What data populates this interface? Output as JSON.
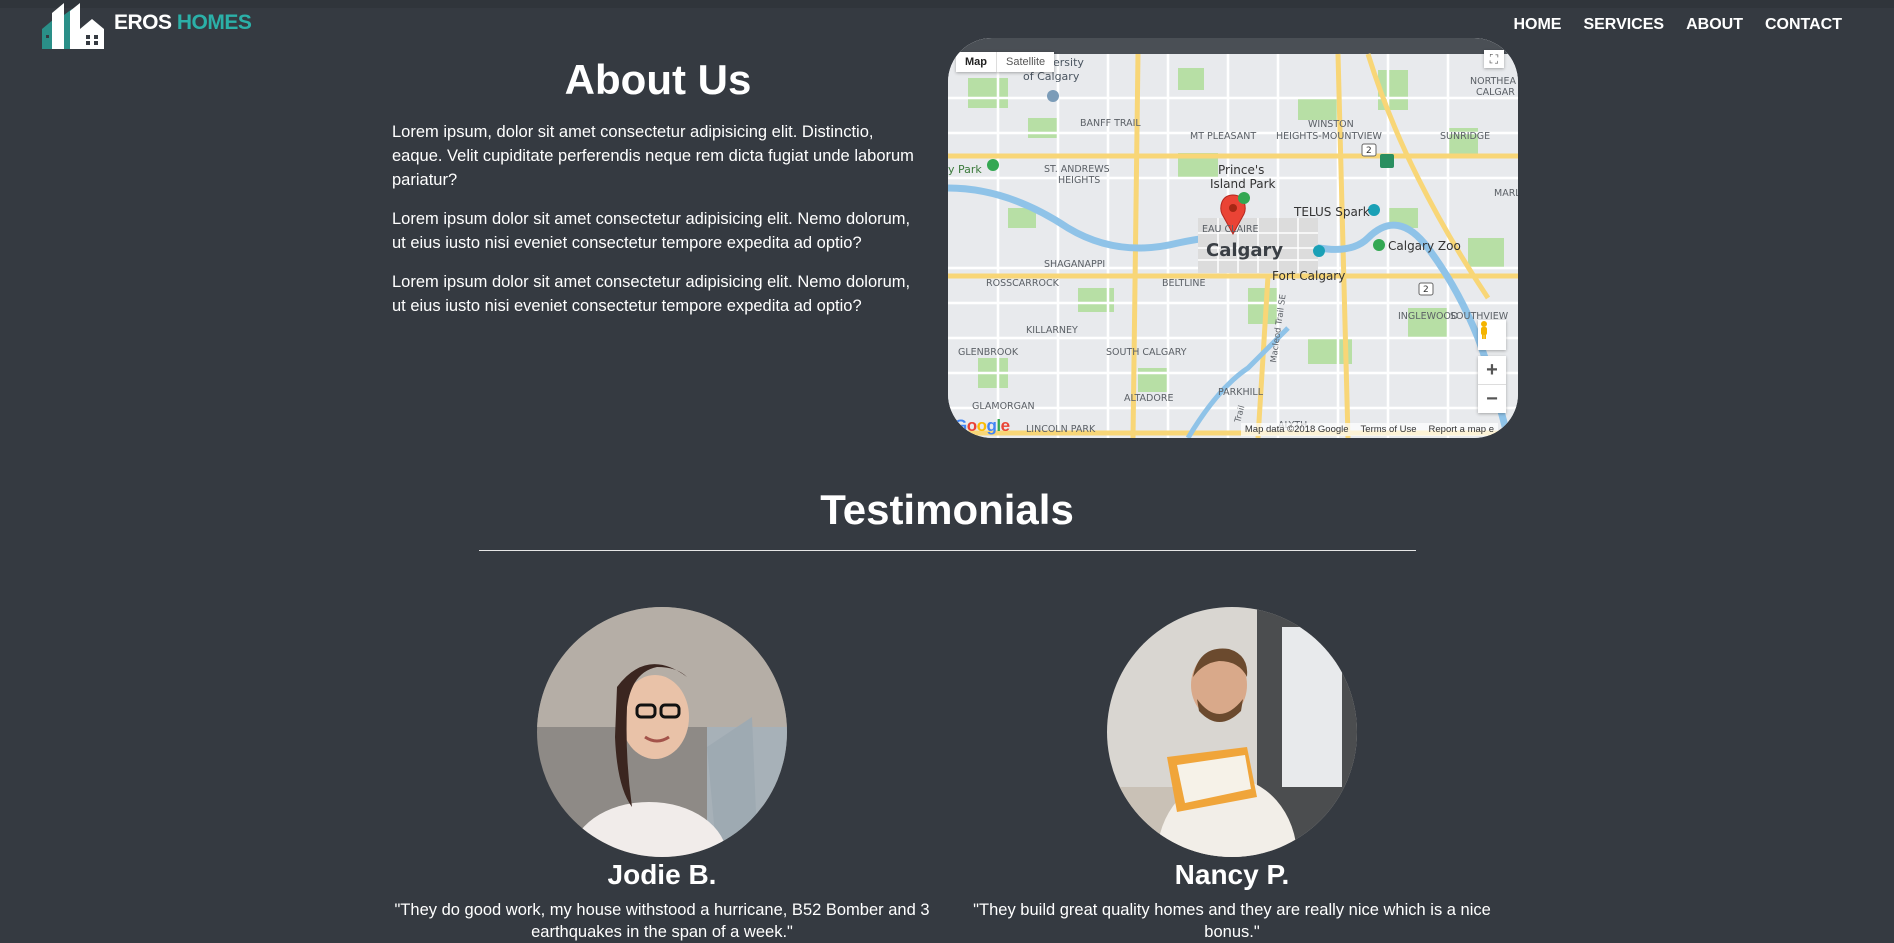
{
  "brand": {
    "part1": "EROS",
    "part2": "HOMES",
    "accent": "#2bb0a8"
  },
  "nav": [
    "HOME",
    "SERVICES",
    "ABOUT",
    "CONTACT"
  ],
  "about": {
    "title": "About Us",
    "paragraphs": [
      "Lorem ipsum, dolor sit amet consectetur adipisicing elit. Distinctio, eaque. Velit cupiditate perferendis neque rem dicta fugiat unde laborum pariatur?",
      "Lorem ipsum dolor sit amet consectetur adipisicing elit. Nemo dolorum, ut eius iusto nisi eveniet consectetur tempore expedita ad optio?",
      "Lorem ipsum dolor sit amet consectetur adipisicing elit. Nemo dolorum, ut eius iusto nisi eveniet consectetur tempore expedita ad optio?"
    ]
  },
  "map": {
    "tabs": {
      "map": "Map",
      "satellite": "Satellite"
    },
    "city": "Calgary",
    "labels": {
      "university": "ersity",
      "of_calgary": "of Calgary",
      "northeast": "NORTHEA",
      "calgary_edge": "CALGAR",
      "banff_trail": "BANFF TRAIL",
      "mt_pleasant": "MT PLEASANT",
      "winston": "WINSTON",
      "heights_mountview": "HEIGHTS-MOUNTVIEW",
      "sunridge": "SUNRIDGE",
      "y_park": "y Park",
      "st_andrews": "ST. ANDREWS",
      "heights": "HEIGHTS",
      "princes": "Prince's",
      "island_park": "Island Park",
      "marl": "MARL",
      "telus_spark": "TELUS Spark",
      "eau_claire": "EAU CLAIRE",
      "calgary_zoo": "Calgary Zoo",
      "shaganappi": "SHAGANAPPI",
      "rosscarrock": "ROSSCARROCK",
      "beltline": "BELTLINE",
      "fort_calgary": "Fort Calgary",
      "inglewood": "INGLEWOOD",
      "southview": "SOUTHVIEW",
      "killarney": "KILLARNEY",
      "macleod": "Macleod Trail SE",
      "glenbrook": "GLENBROOK",
      "south_calgary": "SOUTH CALGARY",
      "altadore": "ALTADORE",
      "parkhill": "PARKHILL",
      "glamorgan": "GLAMORGAN",
      "lincoln_park": "LINCOLN PARK",
      "alyth": "ALYTH",
      "trail": "Trail",
      "route_2": "2"
    },
    "footer": {
      "data": "Map data ©2018 Google",
      "terms": "Terms of Use",
      "report": "Report a map e"
    },
    "google": [
      "G",
      "o",
      "o",
      "g",
      "l",
      "e"
    ]
  },
  "testimonials": {
    "title": "Testimonials",
    "items": [
      {
        "name": "Jodie B.",
        "quote": "\"They do good work, my house withstood a hurricane, B52 Bomber and 3 earthquakes in the span of a week.\""
      },
      {
        "name": "Nancy P.",
        "quote": "\"They build great quality homes and they are really nice which is a nice bonus.\""
      }
    ]
  }
}
